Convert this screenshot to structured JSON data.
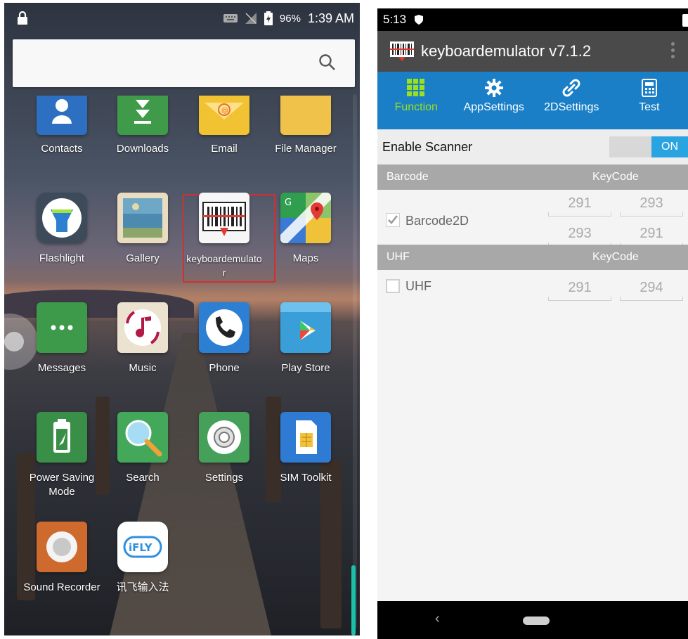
{
  "left": {
    "status": {
      "battery_percent": "96%",
      "time": "1:39 AM"
    },
    "apps": [
      {
        "label": "Contacts",
        "icon": "contacts-icon"
      },
      {
        "label": "Downloads",
        "icon": "downloads-icon"
      },
      {
        "label": "Email",
        "icon": "email-icon"
      },
      {
        "label": "File Manager",
        "icon": "file-manager-icon"
      },
      {
        "label": "Flashlight",
        "icon": "flashlight-icon"
      },
      {
        "label": "Gallery",
        "icon": "gallery-icon"
      },
      {
        "label": "keyboardemulator",
        "icon": "barcode-icon"
      },
      {
        "label": "Maps",
        "icon": "maps-icon"
      },
      {
        "label": "Messages",
        "icon": "messages-icon"
      },
      {
        "label": "Music",
        "icon": "music-icon"
      },
      {
        "label": "Phone",
        "icon": "phone-icon"
      },
      {
        "label": "Play Store",
        "icon": "play-store-icon"
      },
      {
        "label": "Power Saving Mode",
        "icon": "power-saving-icon"
      },
      {
        "label": "Search",
        "icon": "search-app-icon"
      },
      {
        "label": "Settings",
        "icon": "settings-icon"
      },
      {
        "label": "SIM Toolkit",
        "icon": "sim-toolkit-icon"
      },
      {
        "label": "Sound Recorder",
        "icon": "sound-recorder-icon"
      },
      {
        "label": "讯飞输入法",
        "icon": "ifly-icon",
        "icon_text": "iFLY"
      }
    ]
  },
  "right": {
    "status": {
      "time": "5:13"
    },
    "appbar": {
      "title": "keyboardemulator v7.1.2"
    },
    "tabs": [
      {
        "label": "Function",
        "active": true
      },
      {
        "label": "AppSettings"
      },
      {
        "label": "2DSettings"
      },
      {
        "label": "Test"
      }
    ],
    "enable_scanner": {
      "label": "Enable Scanner",
      "state": "ON"
    },
    "barcode_section": {
      "header": "Barcode",
      "keycode_header": "KeyCode",
      "item": {
        "label": "Barcode2D",
        "checked": true,
        "keycodes": [
          "291",
          "293",
          "293",
          "291"
        ]
      }
    },
    "uhf_section": {
      "header": "UHF",
      "keycode_header": "KeyCode",
      "item": {
        "label": "UHF",
        "checked": false,
        "keycodes": [
          "291",
          "294"
        ]
      }
    },
    "nav": {
      "back_glyph": "‹"
    }
  },
  "colors": {
    "accent": "#1a7fc6",
    "active_tab": "#9be01a",
    "toggle_on": "#2aa4e0",
    "highlight": "#d32f2f"
  }
}
